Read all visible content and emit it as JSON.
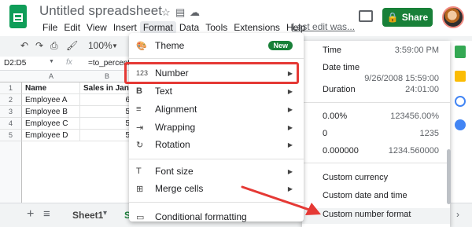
{
  "app": {
    "title": "Untitled spreadsheet",
    "last_edit": "Last edit was...",
    "share_label": "Share"
  },
  "menubar": [
    "File",
    "Edit",
    "View",
    "Insert",
    "Format",
    "Data",
    "Tools",
    "Extensions",
    "Help"
  ],
  "toolbar": {
    "zoom": "100%"
  },
  "formula": {
    "cell_ref": "D2:D5",
    "fx": "fx",
    "value": "=to_percent"
  },
  "grid": {
    "columns": [
      "A",
      "B"
    ],
    "rows": [
      "1",
      "2",
      "3",
      "4",
      "5"
    ],
    "cells": [
      [
        "Name",
        "Sales in Jan"
      ],
      [
        "Employee A",
        "6"
      ],
      [
        "Employee B",
        "5"
      ],
      [
        "Employee C",
        "5"
      ],
      [
        "Employee D",
        "5"
      ]
    ]
  },
  "sheets": {
    "add": "+",
    "list": "≡",
    "sheet1": "Sheet1",
    "sheet2": "S"
  },
  "format_menu": {
    "theme": "Theme",
    "theme_badge": "New",
    "number": "Number",
    "text": "Text",
    "alignment": "Alignment",
    "wrapping": "Wrapping",
    "rotation": "Rotation",
    "font_size": "Font size",
    "merge_cells": "Merge cells",
    "conditional": "Conditional formatting",
    "icons": {
      "theme": "🎨",
      "number": "123",
      "text": "B",
      "alignment": "≡",
      "wrapping": "⇥",
      "rotation": "↻",
      "font_size": "T",
      "merge": "⊞",
      "conditional": "▭"
    }
  },
  "number_submenu": [
    {
      "label": "Time",
      "value": "3:59:00 PM"
    },
    {
      "label": "Date time",
      "value": "9/26/2008 15:59:00"
    },
    {
      "label": "Duration",
      "value": "24:01:00"
    },
    {
      "label": "0.00%",
      "value": "123456.00%"
    },
    {
      "label": "0",
      "value": "1235"
    },
    {
      "label": "0.000000",
      "value": "1234.560000"
    },
    {
      "label": "Custom currency",
      "value": ""
    },
    {
      "label": "Custom date and time",
      "value": ""
    },
    {
      "label": "Custom number format",
      "value": ""
    }
  ],
  "colors": {
    "accent": "#188038",
    "highlight": "#e53935"
  }
}
